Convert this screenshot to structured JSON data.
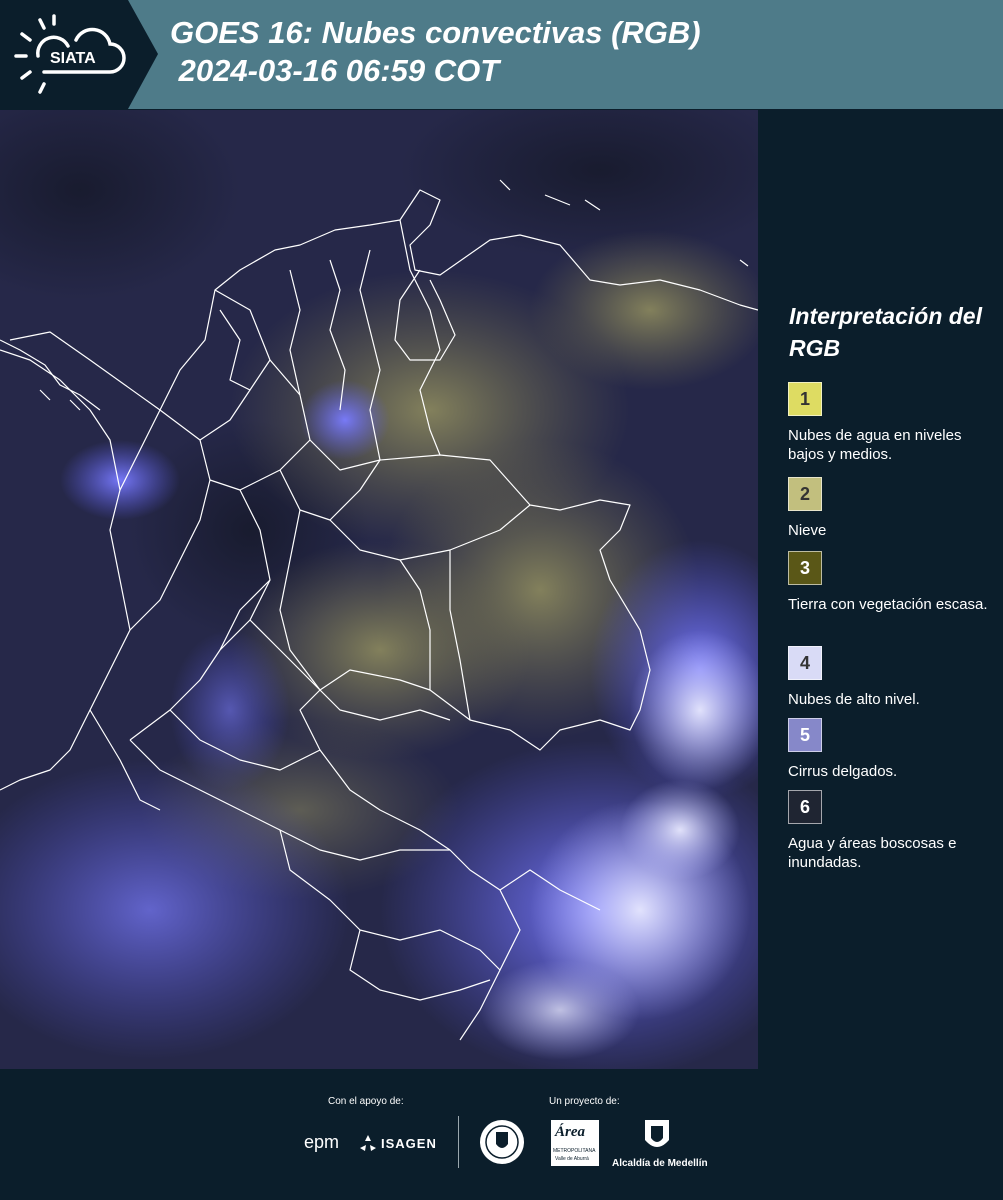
{
  "header": {
    "logo_text": "SIATA",
    "title_line1": "GOES 16: Nubes convectivas (RGB)",
    "title_line2": " 2024-03-16 06:59 COT"
  },
  "legend": {
    "title": "Interpretación del RGB",
    "items": [
      {
        "number": "1",
        "label": "Nubes de agua en niveles bajos y medios.",
        "color": "#dedc62"
      },
      {
        "number": "2",
        "label": "Nieve",
        "color": "#c2bf7e"
      },
      {
        "number": "3",
        "label": "Tierra con vegetación escasa.",
        "color": "#5a5717"
      },
      {
        "number": "4",
        "label": "Nubes de alto nivel.",
        "color": "#d9dbf6"
      },
      {
        "number": "5",
        "label": "Cirrus delgados.",
        "color": "#8688c9"
      },
      {
        "number": "6",
        "label": "Agua y áreas boscosas e inundadas.",
        "color": "#1f2532"
      }
    ]
  },
  "footer": {
    "support_label": "Con el apoyo de:",
    "project_label": "Un proyecto de:",
    "epm": "epm",
    "isagen": "ISAGEN",
    "area_text": "Área",
    "area_sub": "METROPOLITANA",
    "area_sub2": "Valle de Aburrá",
    "alcaldia": "Alcaldía de Medellín"
  },
  "colors": {
    "header_bg": "#4e7b89",
    "page_bg": "#0b1e2b",
    "map_bg": "#25274a",
    "cloud_high": "#6f70f0",
    "land_yellow": "#8a8655"
  }
}
